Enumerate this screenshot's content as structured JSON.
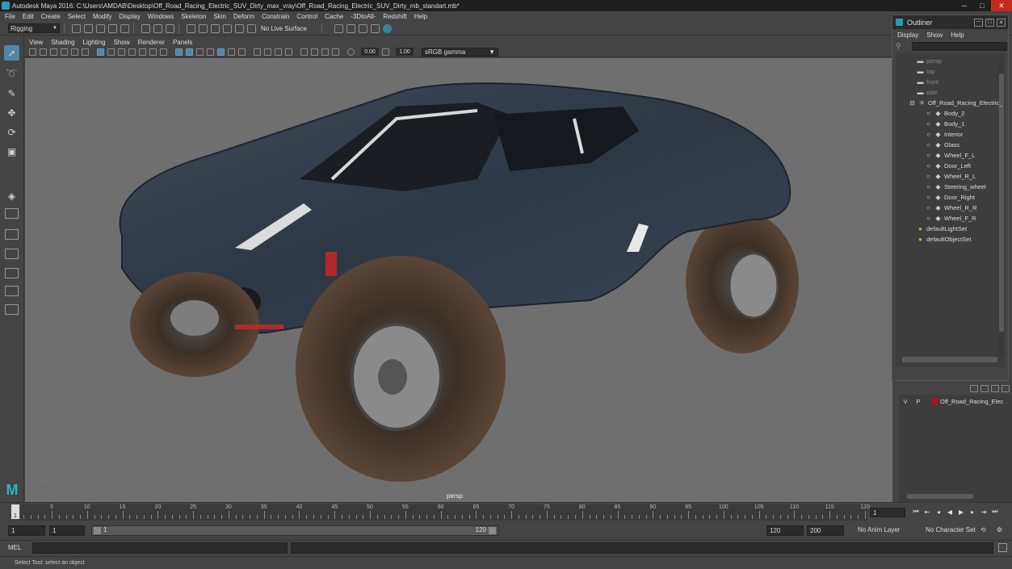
{
  "window": {
    "title": "Autodesk Maya 2016: C:\\Users\\AMDAB\\Desktop\\Off_Road_Racing_Electric_SUV_Dirty_max_vray\\Off_Road_Racing_Electric_SUV_Dirty_mb_standart.mb*",
    "minimize": "─",
    "maximize": "□",
    "close": "✕"
  },
  "menubar": [
    "File",
    "Edit",
    "Create",
    "Select",
    "Modify",
    "Display",
    "Windows",
    "Skeleton",
    "Skin",
    "Deform",
    "Constrain",
    "Control",
    "Cache",
    "-3DtoAll-",
    "Redshift",
    "Help"
  ],
  "shelf": {
    "mode": "Rigging",
    "live_surface": "No Live Surface"
  },
  "viewport": {
    "menu": [
      "View",
      "Shading",
      "Lighting",
      "Show",
      "Renderer",
      "Panels"
    ],
    "exposure": "0.00",
    "gamma_value": "1.00",
    "color_space": "sRGB gamma",
    "camera_label": "persp"
  },
  "outliner": {
    "title": "Outliner",
    "menu": [
      "Display",
      "Show",
      "Help"
    ],
    "items": [
      {
        "label": "persp",
        "kind": "camera",
        "indent": 0,
        "dim": true
      },
      {
        "label": "top",
        "kind": "camera",
        "indent": 0,
        "dim": true
      },
      {
        "label": "front",
        "kind": "camera",
        "indent": 0,
        "dim": true
      },
      {
        "label": "side",
        "kind": "camera",
        "indent": 0,
        "dim": true
      },
      {
        "label": "Off_Road_Racing_Electric_",
        "kind": "group",
        "indent": 0,
        "dim": false
      },
      {
        "label": "Body_2",
        "kind": "mesh",
        "indent": 1,
        "dim": false
      },
      {
        "label": "Body_1",
        "kind": "mesh",
        "indent": 1,
        "dim": false
      },
      {
        "label": "Interior",
        "kind": "mesh",
        "indent": 1,
        "dim": false
      },
      {
        "label": "Glass",
        "kind": "mesh",
        "indent": 1,
        "dim": false
      },
      {
        "label": "Wheel_F_L",
        "kind": "mesh",
        "indent": 1,
        "dim": false
      },
      {
        "label": "Door_Left",
        "kind": "mesh",
        "indent": 1,
        "dim": false
      },
      {
        "label": "Wheel_R_L",
        "kind": "mesh",
        "indent": 1,
        "dim": false
      },
      {
        "label": "Steering_wheel",
        "kind": "mesh",
        "indent": 1,
        "dim": false
      },
      {
        "label": "Door_Right",
        "kind": "mesh",
        "indent": 1,
        "dim": false
      },
      {
        "label": "Wheel_R_R",
        "kind": "mesh",
        "indent": 1,
        "dim": false
      },
      {
        "label": "Wheel_F_R",
        "kind": "mesh",
        "indent": 1,
        "dim": false
      },
      {
        "label": "defaultLightSet",
        "kind": "set",
        "indent": 0,
        "dim": false
      },
      {
        "label": "defaultObjectSet",
        "kind": "set",
        "indent": 0,
        "dim": false
      }
    ]
  },
  "layers": {
    "row": {
      "v": "V",
      "p": "P",
      "name": "Off_Road_Racing_Elec",
      "color": "#9a1a2a"
    }
  },
  "timeline": {
    "ticks": [
      "5",
      "10",
      "15",
      "20",
      "25",
      "30",
      "35",
      "40",
      "45",
      "50",
      "55",
      "60",
      "65",
      "70",
      "75",
      "80",
      "85",
      "90",
      "95",
      "100",
      "105",
      "110",
      "115",
      "120"
    ],
    "playhead_frame": "1",
    "current_frame": "1"
  },
  "range": {
    "start": "1",
    "playback_start": "1",
    "track_start": "1",
    "track_end": "120",
    "playback_end": "120",
    "end": "200",
    "anim_layer": "No Anim Layer",
    "character_set": "No Character Set"
  },
  "cmdline": {
    "lang": "MEL"
  },
  "helpline": {
    "text": "Select Tool: select an object"
  }
}
